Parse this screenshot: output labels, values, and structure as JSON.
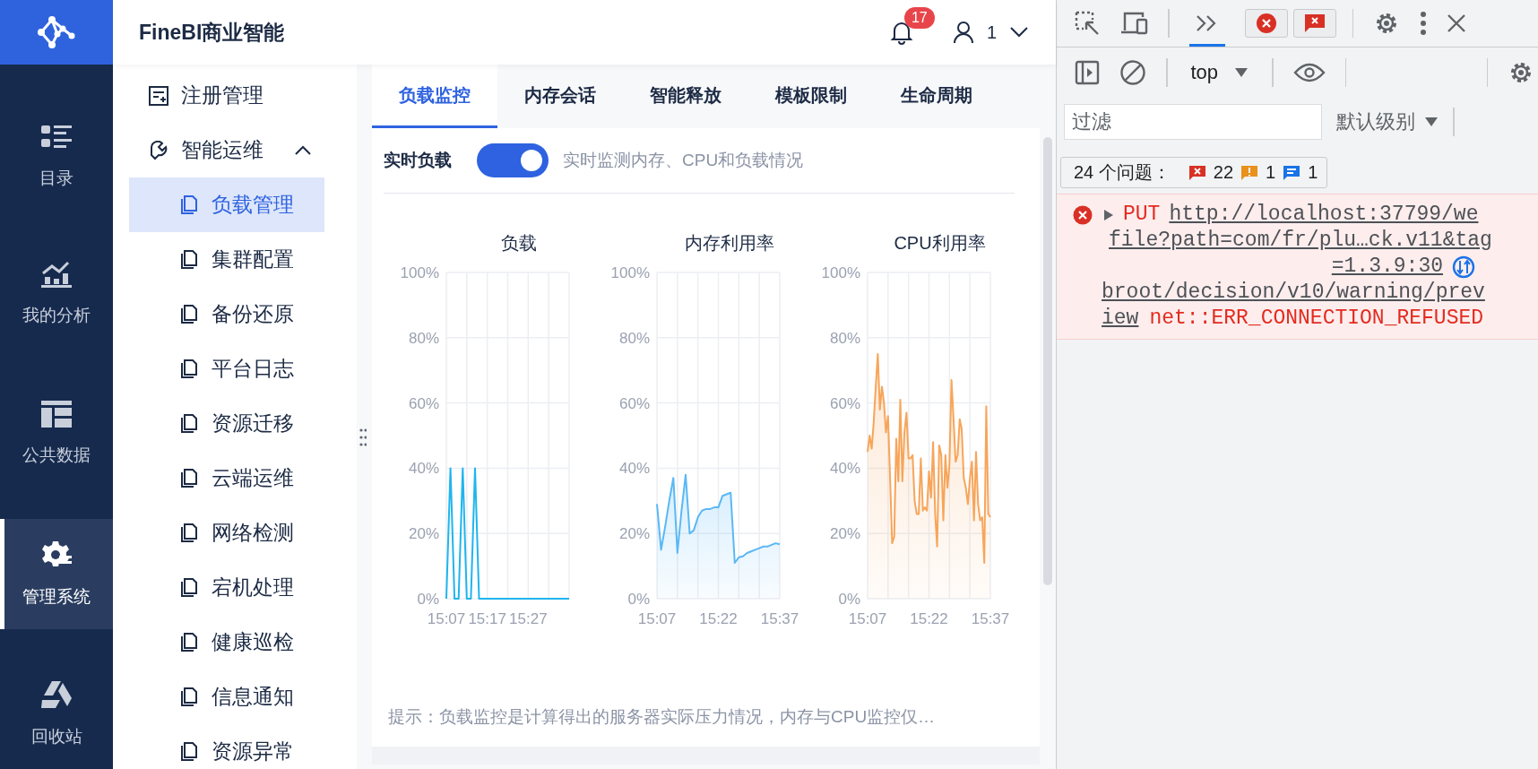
{
  "app": {
    "title": "FineBI商业智能"
  },
  "nav": [
    {
      "label": "目录",
      "selected": false
    },
    {
      "label": "我的分析",
      "selected": false
    },
    {
      "label": "公共数据",
      "selected": false
    },
    {
      "label": "管理系统",
      "selected": true
    },
    {
      "label": "回收站",
      "selected": false
    }
  ],
  "header": {
    "notification_count": "17",
    "user": "1"
  },
  "sidebar": {
    "items": [
      {
        "label": "注册管理"
      },
      {
        "label": "智能运维",
        "expanded": true,
        "children": [
          {
            "label": "负载管理",
            "selected": true
          },
          {
            "label": "集群配置",
            "selected": false
          },
          {
            "label": "备份还原",
            "selected": false
          },
          {
            "label": "平台日志",
            "selected": false
          },
          {
            "label": "资源迁移",
            "selected": false
          },
          {
            "label": "云端运维",
            "selected": false
          },
          {
            "label": "网络检测",
            "selected": false
          },
          {
            "label": "宕机处理",
            "selected": false
          },
          {
            "label": "健康巡检",
            "selected": false
          },
          {
            "label": "信息通知",
            "selected": false
          },
          {
            "label": "资源异常",
            "selected": false
          }
        ]
      }
    ]
  },
  "tabs": [
    {
      "label": "负载监控",
      "selected": true
    },
    {
      "label": "内存会话",
      "selected": false
    },
    {
      "label": "智能释放",
      "selected": false
    },
    {
      "label": "模板限制",
      "selected": false
    },
    {
      "label": "生命周期",
      "selected": false
    }
  ],
  "realtime": {
    "label": "实时负载",
    "on": true,
    "hint": "实时监测内存、CPU和负载情况"
  },
  "charts": [
    {
      "chart_data": {
        "type": "line",
        "title": "负载",
        "grid": true,
        "categories": [
          "15:07",
          null,
          null,
          null,
          null,
          null,
          null,
          null,
          null,
          null,
          "15:17",
          null,
          null,
          null,
          null,
          null,
          null,
          null,
          null,
          null,
          "15:27",
          null,
          null,
          null,
          null,
          null,
          null,
          null,
          null,
          null,
          null
        ],
        "ylim": [
          0,
          100
        ],
        "yticks": [
          {
            "value": 0,
            "label": "0%"
          },
          {
            "value": 20,
            "label": "20%"
          },
          {
            "value": 40,
            "label": "40%"
          },
          {
            "value": 60,
            "label": "60%"
          },
          {
            "value": 80,
            "label": "80%"
          },
          {
            "value": 100,
            "label": "100%"
          }
        ],
        "series": [
          {
            "color": "#1fb5ee",
            "values": [
              0,
              40,
              0,
              0,
              40,
              0,
              0,
              40,
              0,
              0,
              0,
              0,
              0,
              0,
              0,
              0,
              0,
              0,
              0,
              0,
              0,
              0,
              0,
              0,
              0,
              0,
              0,
              0,
              0,
              0,
              0
            ]
          }
        ]
      }
    },
    {
      "chart_data": {
        "type": "area",
        "title": "内存利用率",
        "grid": true,
        "categories": [
          "15:07",
          null,
          null,
          null,
          null,
          null,
          null,
          null,
          null,
          null,
          null,
          null,
          null,
          null,
          null,
          "15:22",
          null,
          null,
          null,
          null,
          null,
          null,
          null,
          null,
          null,
          null,
          null,
          null,
          null,
          null,
          "15:37"
        ],
        "ylim": [
          0,
          100
        ],
        "yticks": [
          {
            "value": 0,
            "label": "0%"
          },
          {
            "value": 20,
            "label": "20%"
          },
          {
            "value": 40,
            "label": "40%"
          },
          {
            "value": 60,
            "label": "60%"
          },
          {
            "value": 80,
            "label": "80%"
          },
          {
            "value": 100,
            "label": "100%"
          }
        ],
        "series": [
          {
            "color": "#5ab8f5",
            "values": [
              29,
              15,
              22,
              30,
              37,
              14,
              27,
              38,
              20,
              21,
              25,
              27,
              27.5,
              27.5,
              28,
              28,
              31.5,
              32,
              32.5,
              11,
              12.7,
              13,
              14,
              14.5,
              15,
              15.5,
              16,
              16,
              16.5,
              17,
              16.7
            ]
          }
        ]
      }
    },
    {
      "chart_data": {
        "type": "area",
        "title": "CPU利用率",
        "grid": true,
        "categories": [
          "15:07",
          null,
          null,
          null,
          null,
          null,
          null,
          null,
          null,
          null,
          null,
          null,
          null,
          null,
          null,
          null,
          null,
          null,
          null,
          null,
          null,
          null,
          null,
          null,
          null,
          null,
          null,
          null,
          null,
          null,
          "15:22",
          null,
          null,
          null,
          null,
          null,
          null,
          null,
          null,
          null,
          null,
          null,
          null,
          null,
          null,
          null,
          null,
          null,
          null,
          null,
          null,
          null,
          null,
          null,
          null,
          null,
          null,
          null,
          null,
          null,
          "15:37"
        ],
        "ylim": [
          0,
          100
        ],
        "yticks": [
          {
            "value": 0,
            "label": "0%"
          },
          {
            "value": 20,
            "label": "20%"
          },
          {
            "value": 40,
            "label": "40%"
          },
          {
            "value": 60,
            "label": "60%"
          },
          {
            "value": 80,
            "label": "80%"
          },
          {
            "value": 100,
            "label": "100%"
          }
        ],
        "series": [
          {
            "color": "#f7a55a",
            "values": [
              45,
              50,
              46,
              54,
              65,
              75,
              58,
              65,
              60,
              51,
              56,
              37,
              17,
              19,
              49,
              36,
              61,
              36,
              51,
              57,
              43,
              43,
              44,
              30,
              26,
              26,
              43,
              27,
              28,
              27,
              39,
              31,
              48,
              26,
              16,
              47,
              44,
              24,
              44,
              34,
              41,
              67,
              55,
              42,
              44,
              55,
              52,
              37,
              34,
              29,
              37,
              42,
              24,
              45,
              29,
              24,
              25,
              11,
              59,
              26,
              25
            ]
          }
        ]
      }
    }
  ],
  "tip": "提示：负载监控是计算得出的服务器实际压力情况，内存与CPU监控仅…",
  "devtools": {
    "context": "top",
    "filter": {
      "placeholder": "过滤"
    },
    "level": "默认级别",
    "issues": {
      "label": "24 个问题：",
      "errors": "22",
      "warnings": "1",
      "infos": "1"
    },
    "messages": [
      {
        "kind": "error",
        "method": "PUT",
        "url_lines": [
          "http://localhost:37799/we",
          "broot/decision/v10/warning/prev",
          "iew"
        ],
        "source_lines": [
          "file?path=com/fr/plu…ck.v11&tag",
          "=1.3.9:30"
        ],
        "error": "net::ERR_CONNECTION_REFUSED"
      }
    ]
  }
}
